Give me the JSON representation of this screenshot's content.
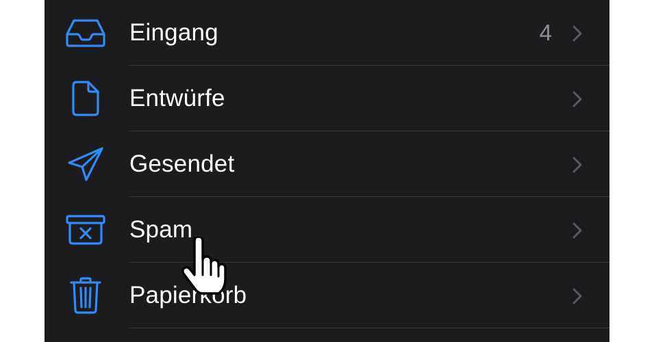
{
  "colors": {
    "background": "#1c1c1e",
    "accent": "#2f8cf7",
    "text": "#ffffff",
    "secondary": "#8e8e93",
    "separator": "#3a3a3c"
  },
  "mailboxes": [
    {
      "label": "Eingang",
      "icon": "inbox-tray-icon",
      "count": "4"
    },
    {
      "label": "Entwürfe",
      "icon": "document-icon",
      "count": ""
    },
    {
      "label": "Gesendet",
      "icon": "paper-plane-icon",
      "count": ""
    },
    {
      "label": "Spam",
      "icon": "junk-bin-icon",
      "count": ""
    },
    {
      "label": "Papierkorb",
      "icon": "trash-icon",
      "count": ""
    }
  ],
  "pointer": {
    "icon": "hand-pointer-cursor-icon"
  }
}
